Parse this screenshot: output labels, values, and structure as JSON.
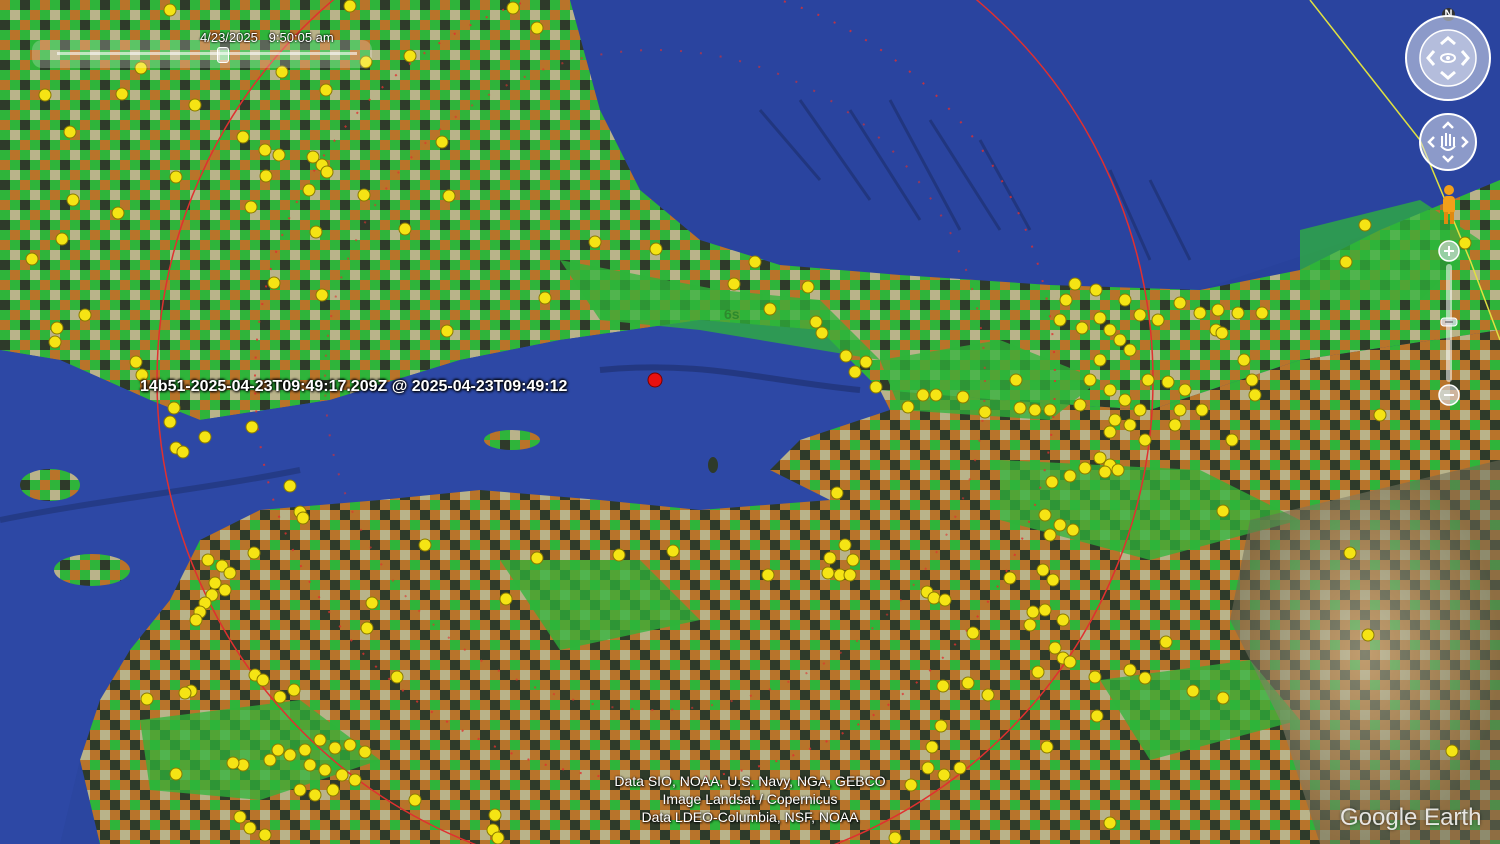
{
  "timeline": {
    "datetime": "4/23/2025   9:50:05 am",
    "position": 0.55
  },
  "placemark": {
    "label": "14b51-2025-04-23T09:49:17.209Z @ 2025-04-23T09:49:12"
  },
  "wave_time_marker": "6s",
  "attribution": {
    "line1": "Data SIO, NOAA, U.S. Navy, NGA, GEBCO",
    "line2": "Image Landsat / Copernicus",
    "line3": "Data LDEO-Columbia, NSF, NOAA"
  },
  "brand": "Google Earth",
  "navigation": {
    "north": "N"
  },
  "colors": {
    "sea": "#2b46a0",
    "land_green": "#2fb43a",
    "land_orange": "#b8742a",
    "land_tan": "#b9b38a",
    "land_dark": "#2e3a2a",
    "station": "#f5e414",
    "epicenter": "#e81010",
    "wave_circle": "#e03030",
    "boundary_line": "#e0e040"
  }
}
